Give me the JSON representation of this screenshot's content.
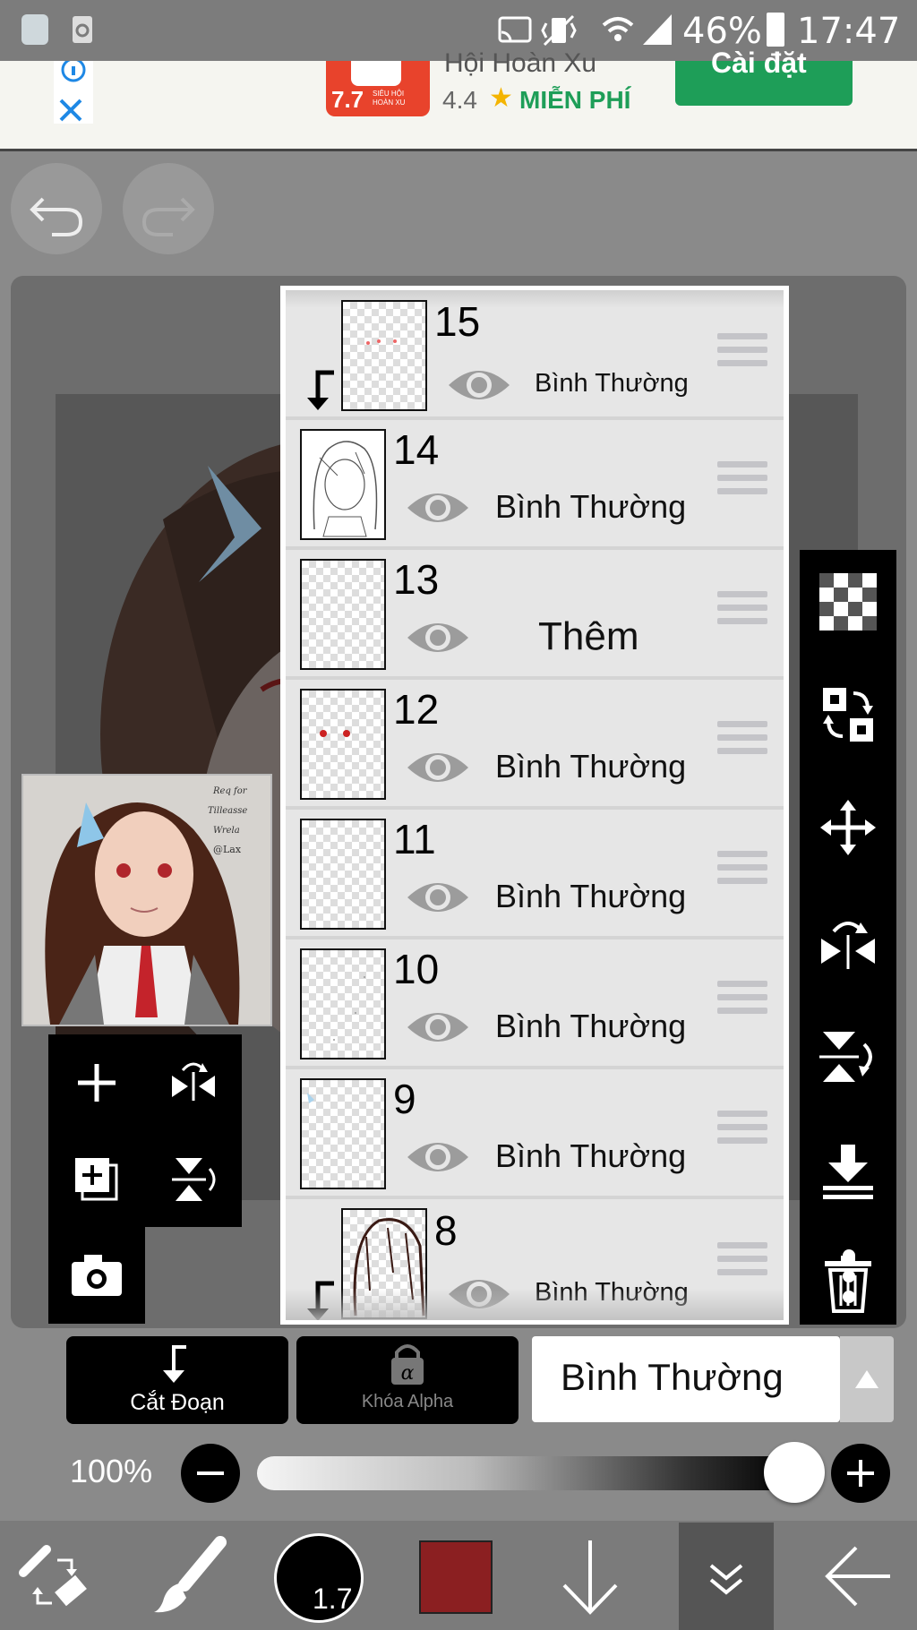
{
  "status_bar": {
    "battery": "46%",
    "time": "17:47"
  },
  "ad": {
    "title": "Hội Hoàn Xu",
    "rating": "4.4",
    "price": "MIỄN PHÍ",
    "install_label": "Cài đặt",
    "app_badge": "7.7",
    "app_badge_sub": "SIÊU HỘI HOÀN XU"
  },
  "thumbnail_text": {
    "line1": "Req for",
    "line2": "Tilleasse",
    "line3": "Wrela",
    "line4": "@Lax"
  },
  "layers": [
    {
      "number": "15",
      "mode": "Bình Thường",
      "clipped": true
    },
    {
      "number": "14",
      "mode": "Bình Thường",
      "clipped": false
    },
    {
      "number": "13",
      "mode": "Thêm",
      "clipped": false
    },
    {
      "number": "12",
      "mode": "Bình Thường",
      "clipped": false
    },
    {
      "number": "11",
      "mode": "Bình Thường",
      "clipped": false
    },
    {
      "number": "10",
      "mode": "Bình Thường",
      "clipped": false
    },
    {
      "number": "9",
      "mode": "Bình Thường",
      "clipped": false
    },
    {
      "number": "8",
      "mode": "Bình Thường",
      "clipped": true
    }
  ],
  "controls": {
    "clip_label": "Cắt Đoạn",
    "alpha_lock_label": "Khóa Alpha",
    "blend_mode": "Bình Thường",
    "opacity": "100%",
    "opacity_value": 1.0
  },
  "brush": {
    "size": "1.7",
    "color": "#8b1f21"
  },
  "colors": {
    "ad_green": "#1e9e58",
    "ad_red": "#e8432c",
    "panel_bg": "#e6e6e6",
    "toolbar_black": "#000000"
  }
}
